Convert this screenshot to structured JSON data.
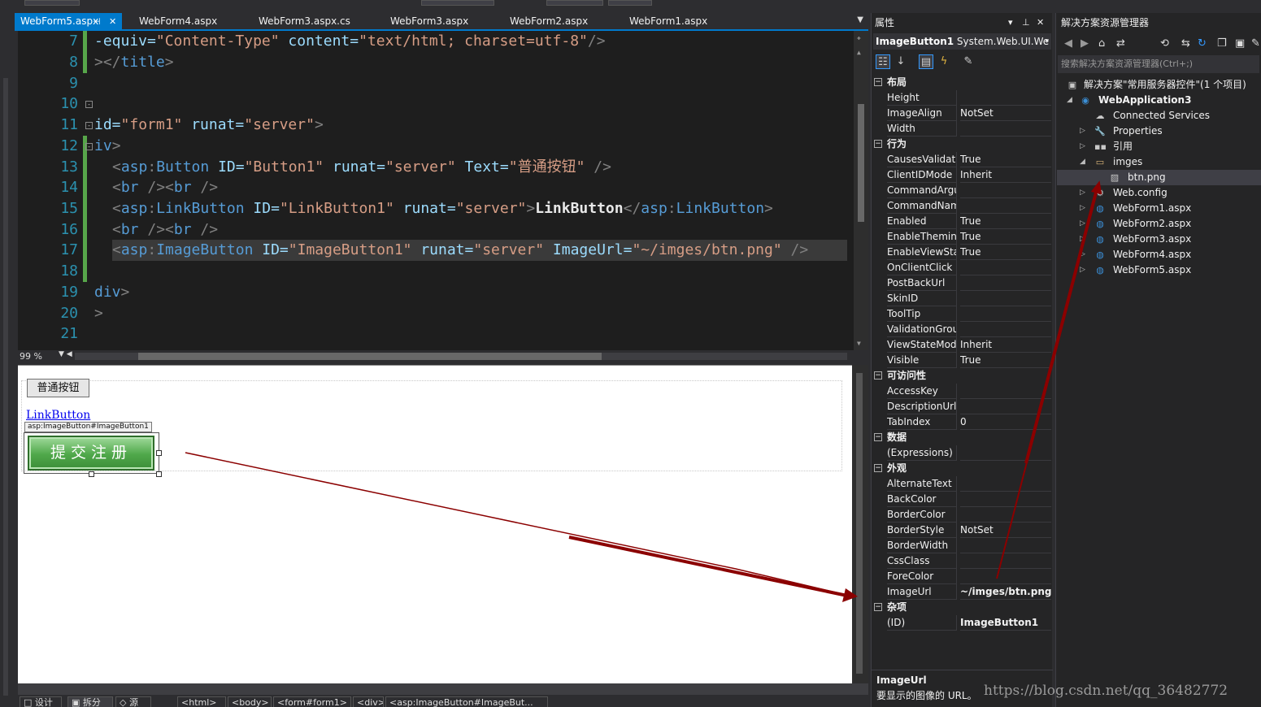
{
  "tabs": [
    {
      "label": "WebForm5.aspx",
      "active": true
    },
    {
      "label": "WebForm4.aspx",
      "active": false
    },
    {
      "label": "WebForm3.aspx.cs",
      "active": false
    },
    {
      "label": "WebForm3.aspx",
      "active": false
    },
    {
      "label": "WebForm2.aspx",
      "active": false
    },
    {
      "label": "WebForm1.aspx",
      "active": false
    }
  ],
  "tab_pin_glyph": "⊣",
  "tab_close_glyph": "✕",
  "editor": {
    "line_numbers": [
      "7",
      "8",
      "9",
      "10",
      "11",
      "12",
      "13",
      "14",
      "15",
      "16",
      "17",
      "18",
      "19",
      "20",
      "21"
    ],
    "lines": {
      "l7": {
        "a": "-equiv=",
        "b": "\"Content-Type\"",
        "c": " content=",
        "d": "\"text/html; charset=utf-8\"",
        "e": "/>"
      },
      "l8": {
        "a": "></",
        "b": "title",
        "c": ">"
      },
      "l11": {
        "a": "id=",
        "b": "\"form1\"",
        "c": " runat=",
        "d": "\"server\"",
        "e": ">"
      },
      "l12": {
        "a": "iv",
        "b": ">"
      },
      "l13": {
        "a": "<",
        "b": "asp",
        "c": ":",
        "d": "Button",
        "e": " ID=",
        "f": "\"Button1\"",
        "g": " runat=",
        "h": "\"server\"",
        "i": " Text=",
        "j": "\"普通按钮\"",
        "k": " />"
      },
      "l14": {
        "a": "<",
        "b": "br",
        "c": " /><",
        "d": "br",
        "e": " />"
      },
      "l15": {
        "a": "<",
        "b": "asp",
        "c": ":",
        "d": "LinkButton",
        "e": " ID=",
        "f": "\"LinkButton1\"",
        "g": " runat=",
        "h": "\"server\"",
        "i": ">",
        "j": "LinkButton",
        "k": "</",
        "l": "asp",
        "m": ":",
        "n": "LinkButton",
        "o": ">"
      },
      "l16": {
        "a": "<",
        "b": "br",
        "c": " /><",
        "d": "br",
        "e": " />"
      },
      "l17": {
        "a": "<",
        "b": "asp",
        "c": ":",
        "d": "ImageButton",
        "e": " ID=",
        "f": "\"ImageButton1\"",
        "g": " runat=",
        "h": "\"server\"",
        "i": " ImageUrl=",
        "j": "\"~/imges/btn.png\"",
        "k": " />"
      },
      "l19": {
        "a": "div",
        "b": ">"
      },
      "l20": {
        "a": ">"
      }
    }
  },
  "zoom": "99 %",
  "design": {
    "normal_button": "普通按钮",
    "link_button": "LinkButton",
    "imagebutton_tag": "asp:ImageButton#ImageButton1",
    "imagebutton_text": "提交注册"
  },
  "statusbar": {
    "items": [
      {
        "label": "□ 设计",
        "active": false
      },
      {
        "label": "▣ 拆分",
        "active": true
      },
      {
        "label": "◇ 源",
        "active": false
      },
      {
        "label": "<html>",
        "active": false
      },
      {
        "label": "<body>",
        "active": false
      },
      {
        "label": "<form#form1>",
        "active": false
      },
      {
        "label": "<div>",
        "active": false
      },
      {
        "label": "<asp:ImageButton#ImageBut...",
        "active": false
      }
    ]
  },
  "properties": {
    "title": "属性",
    "object_name": "ImageButton1",
    "object_type": "System.Web.UI.We",
    "categories": [
      {
        "label": "布局",
        "rows": [
          {
            "name": "Height",
            "value": ""
          },
          {
            "name": "ImageAlign",
            "value": "NotSet"
          },
          {
            "name": "Width",
            "value": ""
          }
        ]
      },
      {
        "label": "行为",
        "rows": [
          {
            "name": "CausesValidati",
            "value": "True"
          },
          {
            "name": "ClientIDMode",
            "value": "Inherit"
          },
          {
            "name": "CommandArgu",
            "value": ""
          },
          {
            "name": "CommandNam",
            "value": ""
          },
          {
            "name": "Enabled",
            "value": "True"
          },
          {
            "name": "EnableTheming",
            "value": "True"
          },
          {
            "name": "EnableViewSta",
            "value": "True"
          },
          {
            "name": "OnClientClick",
            "value": ""
          },
          {
            "name": "PostBackUrl",
            "value": ""
          },
          {
            "name": "SkinID",
            "value": ""
          },
          {
            "name": "ToolTip",
            "value": ""
          },
          {
            "name": "ValidationGrou",
            "value": ""
          },
          {
            "name": "ViewStateMod",
            "value": "Inherit"
          },
          {
            "name": "Visible",
            "value": "True"
          }
        ]
      },
      {
        "label": "可访问性",
        "rows": [
          {
            "name": "AccessKey",
            "value": ""
          },
          {
            "name": "DescriptionUrl",
            "value": ""
          },
          {
            "name": "TabIndex",
            "value": "0"
          }
        ]
      },
      {
        "label": "数据",
        "rows": [
          {
            "name": "(Expressions)",
            "value": ""
          }
        ]
      },
      {
        "label": "外观",
        "rows": [
          {
            "name": "AlternateText",
            "value": ""
          },
          {
            "name": "BackColor",
            "value": ""
          },
          {
            "name": "BorderColor",
            "value": ""
          },
          {
            "name": "BorderStyle",
            "value": "NotSet"
          },
          {
            "name": "BorderWidth",
            "value": ""
          },
          {
            "name": "CssClass",
            "value": ""
          },
          {
            "name": "ForeColor",
            "value": ""
          },
          {
            "name": "ImageUrl",
            "value": "~/imges/btn.png",
            "bold": true
          }
        ]
      },
      {
        "label": "杂项",
        "rows": [
          {
            "name": "(ID)",
            "value": "ImageButton1",
            "bold": true
          }
        ]
      }
    ],
    "desc_title": "ImageUrl",
    "desc_text": "要显示的图像的 URL。"
  },
  "solution": {
    "title": "解决方案资源管理器",
    "search_placeholder": "搜索解决方案资源管理器(Ctrl+;)",
    "nodes": [
      {
        "label": "解决方案\"常用服务器控件\"(1 个项目)",
        "icon": "solution-icon",
        "glyph": "▣",
        "expander": "",
        "bold": false
      },
      {
        "label": "WebApplication3",
        "icon": "web-project-icon",
        "glyph": "◉",
        "expander": "◢",
        "bold": true
      },
      {
        "label": "Connected Services",
        "icon": "connected-services-icon",
        "glyph": "☁",
        "expander": "",
        "bold": false
      },
      {
        "label": "Properties",
        "icon": "wrench-icon",
        "glyph": "🔧",
        "expander": "▷",
        "bold": false
      },
      {
        "label": "引用",
        "icon": "references-icon",
        "glyph": "▪▪",
        "expander": "▷",
        "bold": false
      },
      {
        "label": "imges",
        "icon": "folder-open-icon",
        "glyph": "▭",
        "expander": "◢",
        "bold": false
      },
      {
        "label": "btn.png",
        "icon": "image-file-icon",
        "glyph": "▨",
        "expander": "",
        "bold": false
      },
      {
        "label": "Web.config",
        "icon": "config-file-icon",
        "glyph": "⚙",
        "expander": "▷",
        "bold": false
      },
      {
        "label": "WebForm1.aspx",
        "icon": "aspx-file-icon",
        "glyph": "◍",
        "expander": "▷",
        "bold": false
      },
      {
        "label": "WebForm2.aspx",
        "icon": "aspx-file-icon",
        "glyph": "◍",
        "expander": "▷",
        "bold": false
      },
      {
        "label": "WebForm3.aspx",
        "icon": "aspx-file-icon",
        "glyph": "◍",
        "expander": "▷",
        "bold": false
      },
      {
        "label": "WebForm4.aspx",
        "icon": "aspx-file-icon",
        "glyph": "◍",
        "expander": "▷",
        "bold": false
      },
      {
        "label": "WebForm5.aspx",
        "icon": "aspx-file-icon",
        "glyph": "◍",
        "expander": "▷",
        "bold": false
      }
    ]
  },
  "watermark": "https://blog.csdn.net/qq_36482772",
  "colors": {
    "accent": "#007acc",
    "arrow": "#8b0000",
    "image_button_green": "#4fa84a"
  }
}
